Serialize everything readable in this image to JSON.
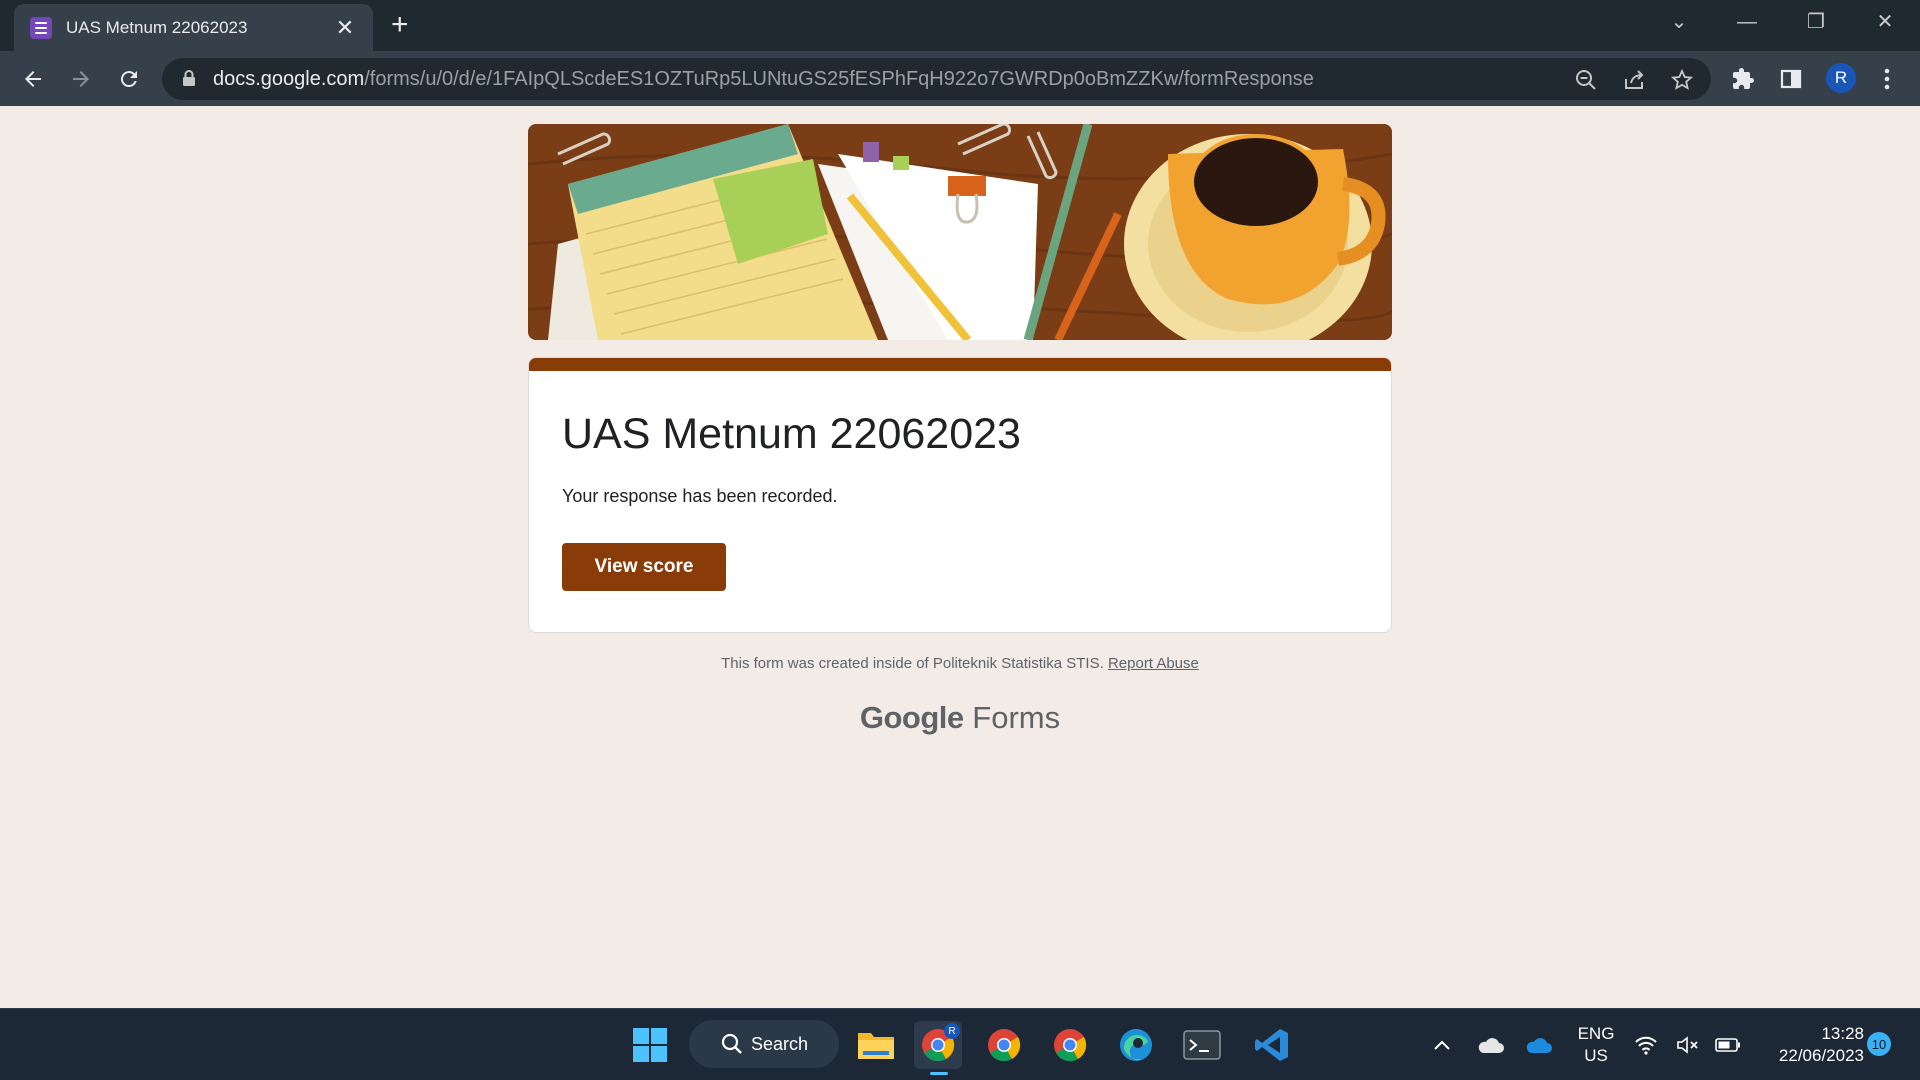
{
  "browser": {
    "tab_title": "UAS Metnum 22062023",
    "url_domain": "docs.google.com",
    "url_path": "/forms/u/0/d/e/1FAIpQLScdeES1OZTuRp5LUNtuGS25fESPhFqH922o7GWRDp0oBmZZKw/formResponse",
    "profile_initial": "R"
  },
  "form": {
    "title": "UAS Metnum 22062023",
    "message": "Your response has been recorded.",
    "button_label": "View score",
    "accent_color": "#8a3c08"
  },
  "footer": {
    "note": "This form was created inside of Politeknik Statistika STIS.",
    "report_link": "Report Abuse",
    "brand_google": "Google",
    "brand_forms": "Forms"
  },
  "taskbar": {
    "search_label": "Search",
    "lang_top": "ENG",
    "lang_bottom": "US",
    "time": "13:28",
    "date": "22/06/2023",
    "notification_count": "10"
  },
  "icons": [
    "forms-icon",
    "close-icon",
    "plus-icon",
    "chevron-down-icon",
    "minimize-icon",
    "restore-icon",
    "back-icon",
    "forward-icon",
    "reload-icon",
    "lock-icon",
    "zoom-out-icon",
    "share-icon",
    "star-icon",
    "extensions-icon",
    "side-panel-icon",
    "menu-icon",
    "windows-start-icon",
    "search-icon",
    "file-explorer-icon",
    "chrome-icon",
    "edge-icon",
    "terminal-icon",
    "vscode-icon",
    "chevron-up-icon",
    "cloud-icon",
    "onedrive-icon",
    "wifi-icon",
    "speaker-muted-icon",
    "battery-icon"
  ]
}
